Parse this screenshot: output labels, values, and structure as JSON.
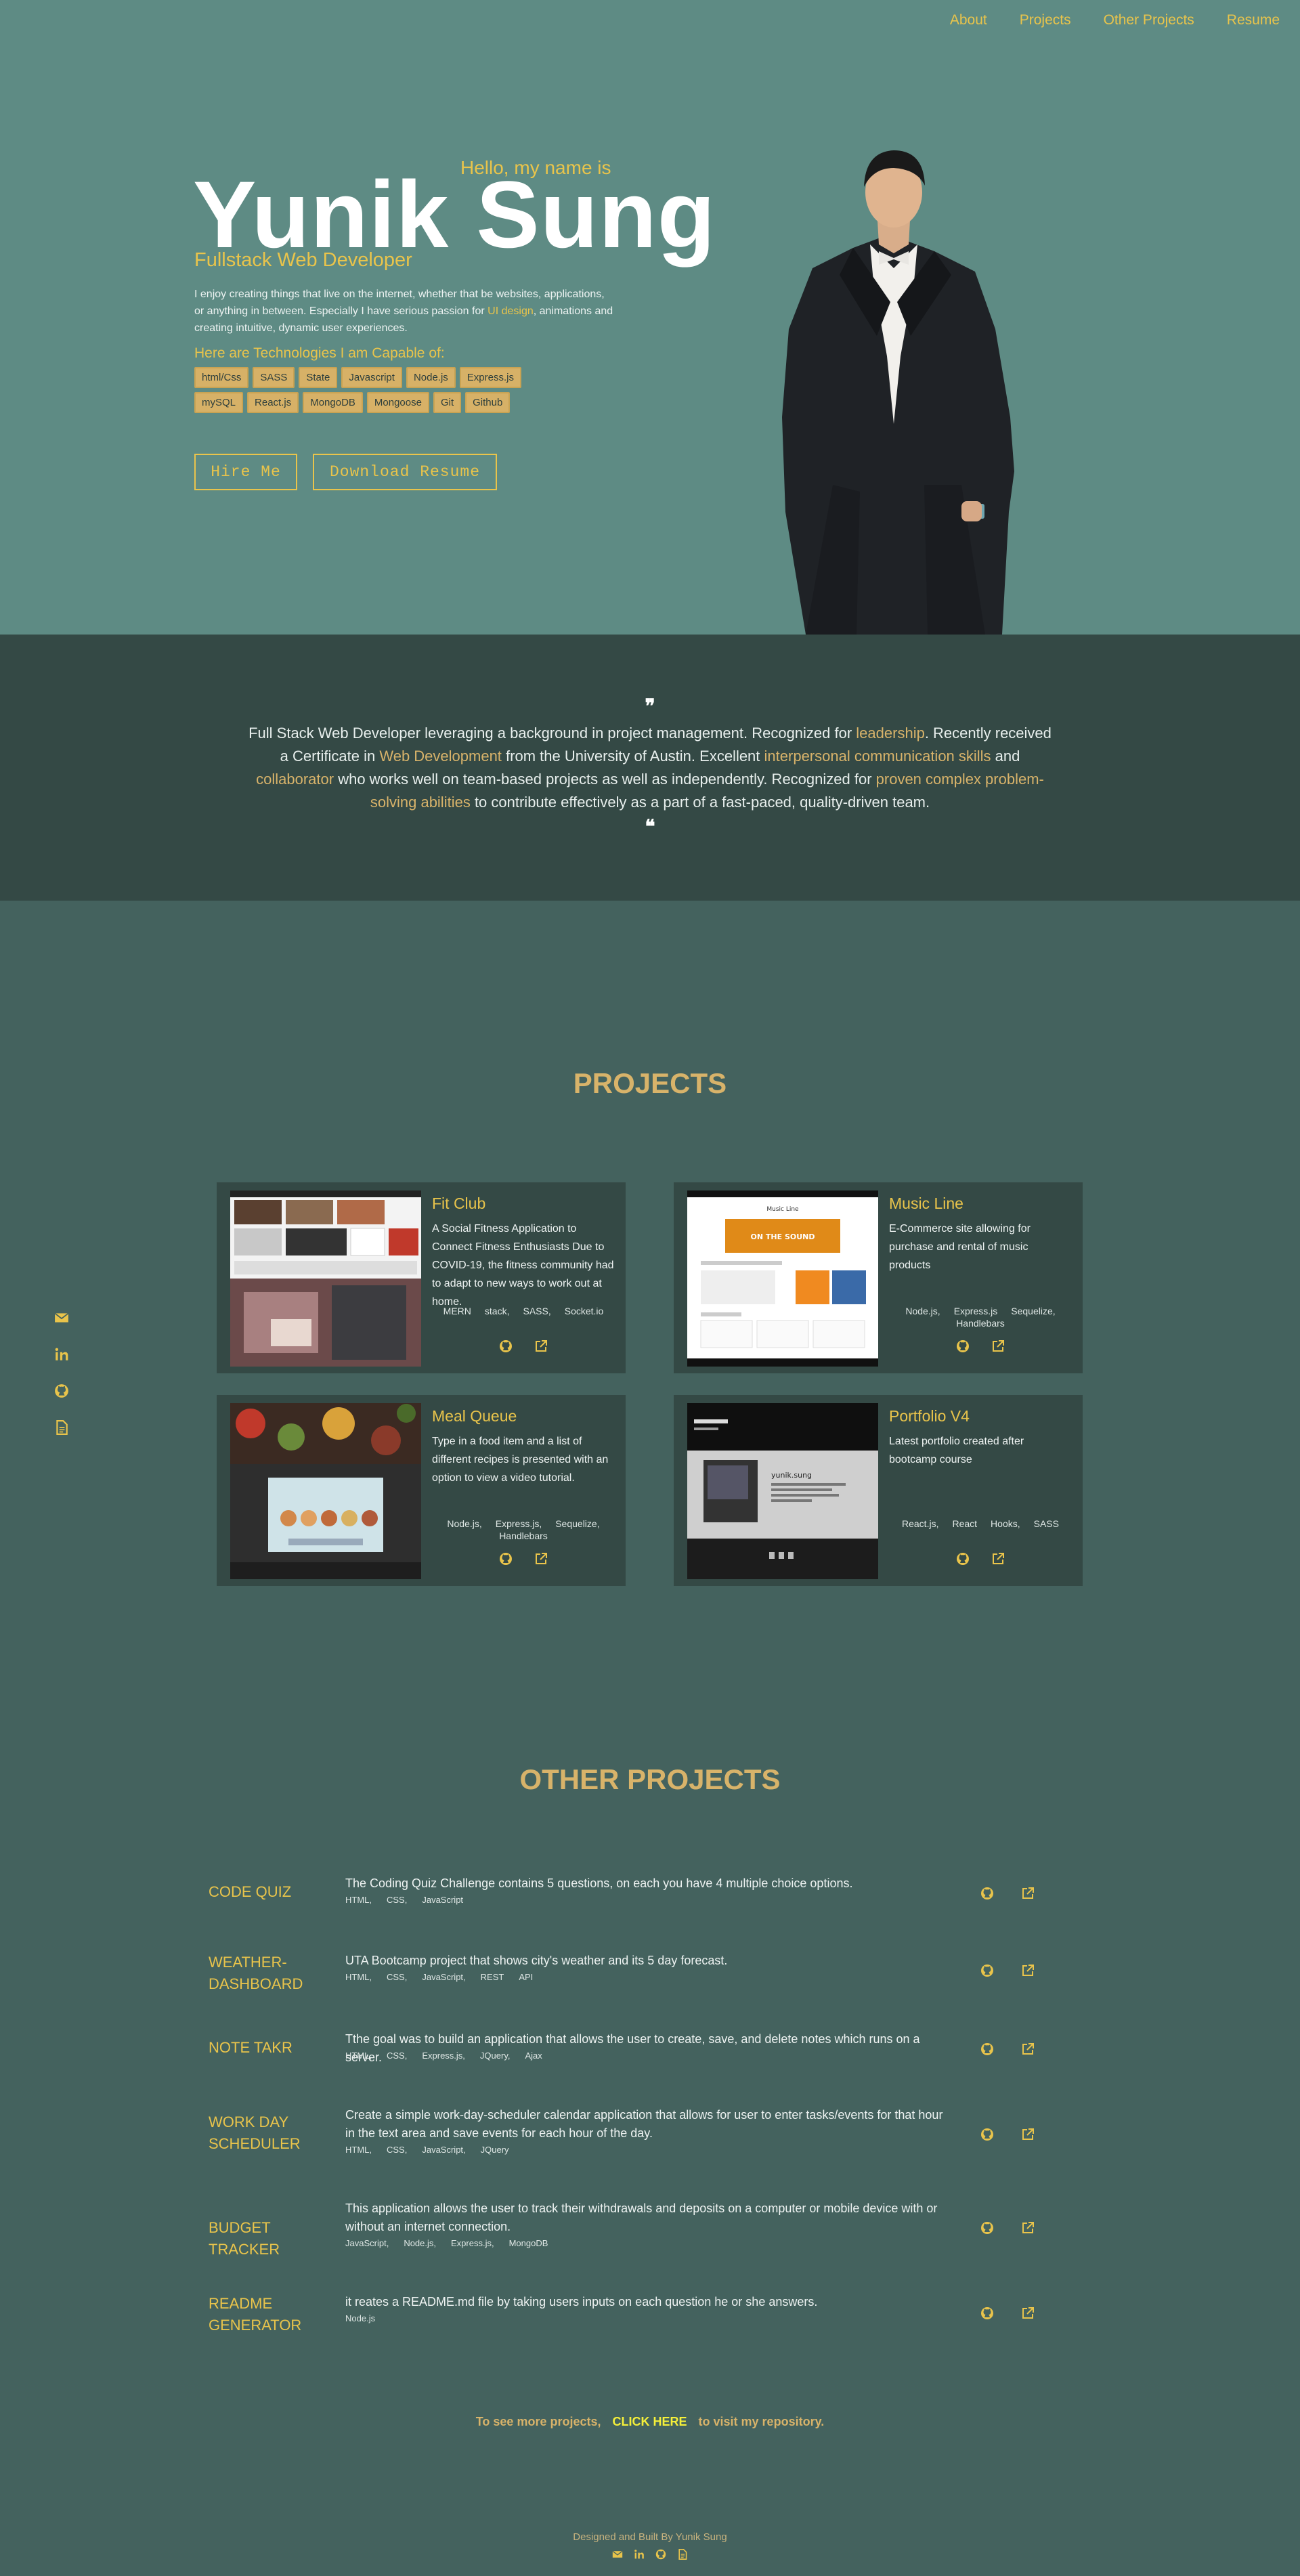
{
  "nav": [
    "About",
    "Projects",
    "Other Projects",
    "Resume"
  ],
  "hero": {
    "greeting": "Hello, my name is",
    "name": "Yunik Sung",
    "role": "Fullstack Web Developer",
    "intro_before": "I enjoy creating things that live on the internet, whether that be websites, applications, or anything in between. Especially I have serious passion for ",
    "intro_highlight": "UI design",
    "intro_after": ", animations and creating intuitive, dynamic user experiences.",
    "tech_header": "Here are Technologies I am Capable of:",
    "techs": [
      "html/Css",
      "SASS",
      "State",
      "Javascript",
      "Node.js",
      "Express.js",
      "mySQL",
      "React.js",
      "MongoDB",
      "Mongoose",
      "Git",
      "Github"
    ],
    "hire_label": "Hire Me",
    "resume_label": "Download Resume"
  },
  "quote": {
    "open_mark": "❞",
    "close_mark": "❝",
    "parts": [
      {
        "t": "Full Stack Web Developer leveraging a background in project management. Recognized for ",
        "h": false
      },
      {
        "t": "leadership",
        "h": true
      },
      {
        "t": ". Recently received a Certificate in ",
        "h": false
      },
      {
        "t": "Web Development",
        "h": true
      },
      {
        "t": " from the University of Austin. Excellent ",
        "h": false
      },
      {
        "t": "interpersonal communication skills",
        "h": true
      },
      {
        "t": " and ",
        "h": false
      },
      {
        "t": "collaborator",
        "h": true
      },
      {
        "t": " who works well on team-based projects as well as independently. Recognized for ",
        "h": false
      },
      {
        "t": "proven complex problem-solving abilities",
        "h": true
      },
      {
        "t": " to contribute effectively as a part of a fast-paced, quality-driven team.",
        "h": false
      }
    ]
  },
  "projects_title": "PROJECTS",
  "projects": [
    {
      "title": "Fit Club",
      "desc": "A Social Fitness Application to Connect Fitness Enthusiasts Due to COVID-19, the fitness community had to adapt to new ways to work out at home.",
      "tags": [
        "MERN",
        "stack,",
        "SASS,",
        "Socket.io"
      ]
    },
    {
      "title": "Music Line",
      "desc": "E-Commerce site allowing for purchase and rental of music products",
      "tags": [
        "Node.js,",
        "Express.js",
        "Sequelize,",
        "Handlebars"
      ]
    },
    {
      "title": "Meal Queue",
      "desc": "Type in a food item and a list of different recipes is presented with an option to view a video tutorial.",
      "tags": [
        "Node.js,",
        "Express.js,",
        "Sequelize,",
        "Handlebars"
      ]
    },
    {
      "title": "Portfolio V4",
      "desc": "Latest portfolio created after bootcamp course",
      "tags": [
        "React.js,",
        "React",
        "Hooks,",
        "SASS"
      ]
    }
  ],
  "thumbs": {
    "music_header": "Music Line",
    "music_banner": "ON THE SOUND",
    "portfolio_name": "yunik.sung"
  },
  "other_title": "OTHER PROJECTS",
  "other_projects": [
    {
      "name": "CODE QUIZ",
      "desc": "The Coding Quiz Challenge contains 5 questions, on each you have 4 multiple choice options.",
      "tags": [
        "HTML,",
        "CSS,",
        "JavaScript"
      ]
    },
    {
      "name": "WEATHER-DASHBOARD",
      "desc": "UTA Bootcamp project that shows city's weather and its 5 day forecast.",
      "tags": [
        "HTML,",
        "CSS,",
        "JavaScript,",
        "REST",
        "API"
      ]
    },
    {
      "name": "NOTE TAKR",
      "desc": "Tthe goal was to build an application that allows the user to create, save, and delete notes which runs on a server.",
      "tags": [
        "HTML,",
        "CSS,",
        "Express.js,",
        "JQuery,",
        "Ajax"
      ]
    },
    {
      "name": "WORK DAY SCHEDULER",
      "desc": "Create a simple work-day-scheduler calendar application that allows for user to enter tasks/events for that hour in the text area and save events for each hour of the day.",
      "tags": [
        "HTML,",
        "CSS,",
        "JavaScript,",
        "JQuery"
      ]
    },
    {
      "name": "BUDGET TRACKER",
      "desc": "This application allows the user to track their withdrawals and deposits on a computer or mobile device with or without an internet connection.",
      "tags": [
        "JavaScript,",
        "Node.js,",
        "Express.js,",
        "MongoDB"
      ]
    },
    {
      "name": "README GENERATOR",
      "desc": "it reates a README.md file by taking users inputs on each question he or she answers.",
      "tags": [
        "Node.js"
      ]
    }
  ],
  "more": {
    "before": "To see more projects,",
    "click": "CLICK HERE",
    "after": "to visit my repository."
  },
  "footer": "Designed and Built By Yunik Sung"
}
